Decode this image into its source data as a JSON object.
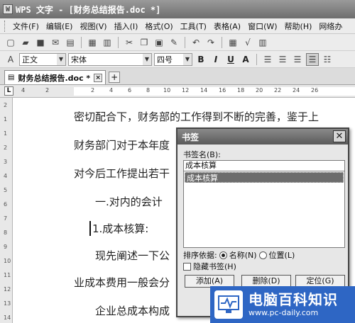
{
  "window": {
    "title": "WPS 文字 - [财务总结报告.doc *]",
    "logo_text": "W"
  },
  "menubar": {
    "items": [
      "文件(F)",
      "编辑(E)",
      "视图(V)",
      "插入(I)",
      "格式(O)",
      "工具(T)",
      "表格(A)",
      "窗口(W)",
      "帮助(H)",
      "网络办"
    ]
  },
  "format_toolbar": {
    "style_value": "正文",
    "font_value": "宋体",
    "size_value": "四号",
    "bold": "B",
    "italic": "I",
    "underline": "U",
    "font_color": "A"
  },
  "tabs": {
    "active_tab": "财务总结报告.doc *",
    "close_glyph": "×",
    "new_glyph": "+"
  },
  "ruler": {
    "corner": "L",
    "numbers": [
      "4",
      "2",
      "2",
      "4",
      "6",
      "8",
      "10",
      "12",
      "14",
      "16",
      "18",
      "20",
      "22",
      "24",
      "26"
    ]
  },
  "vruler": {
    "numbers": [
      "2",
      "1",
      "1",
      "2",
      "3",
      "4",
      "5",
      "6",
      "7",
      "8",
      "9",
      "10",
      "11",
      "12",
      "13",
      "14"
    ]
  },
  "document": {
    "lines": [
      "密切配合下，财务部的工作得到不断的完善，鉴于上",
      "财务部门对于本年度",
      "对今后工作提出若干",
      "一.对内的会计",
      "1.成本核算:",
      "现先阐述一下公",
      "业成本费用一般会分",
      "企业总成本构成"
    ]
  },
  "bookmark_dialog": {
    "title": "书签",
    "name_label": "书签名(B):",
    "name_value": "成本核算",
    "list_items": [
      "成本核算"
    ],
    "sort_label": "排序依据:",
    "sort_options": [
      "名称(N)",
      "位置(L)"
    ],
    "sort_selected": "名称(N)",
    "hidden_label": "隐藏书签(H)",
    "hidden_checked": false,
    "buttons": {
      "add": "添加(A)",
      "delete": "删除(D)",
      "goto": "定位(G)"
    }
  },
  "watermark": {
    "brand": "电脑百科知识",
    "url": "www.pc-daily.com"
  }
}
